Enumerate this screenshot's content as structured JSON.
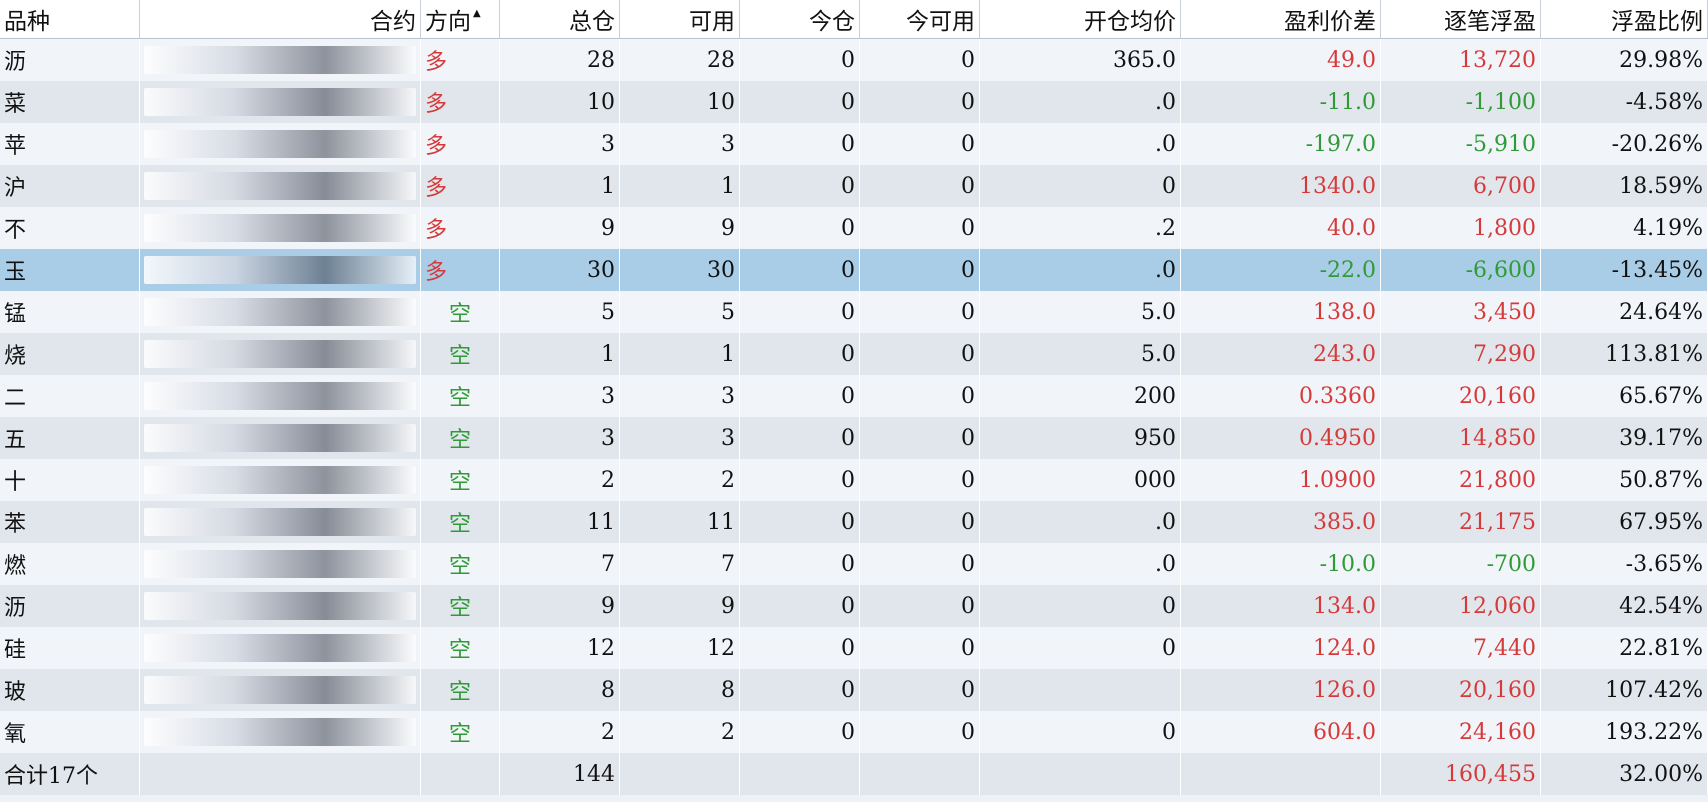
{
  "headers": {
    "variety": "品种",
    "contract": "合约",
    "direction": "方向",
    "total": "总仓",
    "available": "可用",
    "today": "今仓",
    "today_available": "今可用",
    "avg_open": "开仓均价",
    "price_diff": "盈利价差",
    "float_pl": "逐笔浮盈",
    "pl_ratio": "浮盈比例"
  },
  "colors": {
    "long": "#d43a3a",
    "short": "#2f9a36",
    "selected_row": "#a9cde6"
  },
  "rows": [
    {
      "variety": "沥",
      "direction": "多",
      "total": "28",
      "available": "28",
      "today": "0",
      "today_available": "0",
      "avg_open": "365.0",
      "price_diff": "49.0",
      "float_pl": "13,720",
      "pl_ratio": "29.98%",
      "sign": "pos"
    },
    {
      "variety": "菜",
      "direction": "多",
      "total": "10",
      "available": "10",
      "today": "0",
      "today_available": "0",
      "avg_open": ".0",
      "price_diff": "-11.0",
      "float_pl": "-1,100",
      "pl_ratio": "-4.58%",
      "sign": "neg"
    },
    {
      "variety": "苹",
      "direction": "多",
      "total": "3",
      "available": "3",
      "today": "0",
      "today_available": "0",
      "avg_open": ".0",
      "price_diff": "-197.0",
      "float_pl": "-5,910",
      "pl_ratio": "-20.26%",
      "sign": "neg"
    },
    {
      "variety": "沪",
      "direction": "多",
      "total": "1",
      "available": "1",
      "today": "0",
      "today_available": "0",
      "avg_open": "0",
      "price_diff": "1340.0",
      "float_pl": "6,700",
      "pl_ratio": "18.59%",
      "sign": "pos"
    },
    {
      "variety": "不",
      "direction": "多",
      "total": "9",
      "available": "9",
      "today": "0",
      "today_available": "0",
      "avg_open": ".2",
      "price_diff": "40.0",
      "float_pl": "1,800",
      "pl_ratio": "4.19%",
      "sign": "pos"
    },
    {
      "variety": "玉",
      "direction": "多",
      "total": "30",
      "available": "30",
      "today": "0",
      "today_available": "0",
      "avg_open": ".0",
      "price_diff": "-22.0",
      "float_pl": "-6,600",
      "pl_ratio": "-13.45%",
      "sign": "neg",
      "selected": true
    },
    {
      "variety": "锰",
      "direction": "空",
      "total": "5",
      "available": "5",
      "today": "0",
      "today_available": "0",
      "avg_open": "5.0",
      "price_diff": "138.0",
      "float_pl": "3,450",
      "pl_ratio": "24.64%",
      "sign": "pos"
    },
    {
      "variety": "烧",
      "direction": "空",
      "total": "1",
      "available": "1",
      "today": "0",
      "today_available": "0",
      "avg_open": "5.0",
      "price_diff": "243.0",
      "float_pl": "7,290",
      "pl_ratio": "113.81%",
      "sign": "pos"
    },
    {
      "variety": "二",
      "direction": "空",
      "total": "3",
      "available": "3",
      "today": "0",
      "today_available": "0",
      "avg_open": "200",
      "price_diff": "0.3360",
      "float_pl": "20,160",
      "pl_ratio": "65.67%",
      "sign": "pos"
    },
    {
      "variety": "五",
      "direction": "空",
      "total": "3",
      "available": "3",
      "today": "0",
      "today_available": "0",
      "avg_open": "950",
      "price_diff": "0.4950",
      "float_pl": "14,850",
      "pl_ratio": "39.17%",
      "sign": "pos"
    },
    {
      "variety": "十",
      "direction": "空",
      "total": "2",
      "available": "2",
      "today": "0",
      "today_available": "0",
      "avg_open": "000",
      "price_diff": "1.0900",
      "float_pl": "21,800",
      "pl_ratio": "50.87%",
      "sign": "pos"
    },
    {
      "variety": "苯",
      "direction": "空",
      "total": "11",
      "available": "11",
      "today": "0",
      "today_available": "0",
      "avg_open": ".0",
      "price_diff": "385.0",
      "float_pl": "21,175",
      "pl_ratio": "67.95%",
      "sign": "pos"
    },
    {
      "variety": "燃",
      "direction": "空",
      "total": "7",
      "available": "7",
      "today": "0",
      "today_available": "0",
      "avg_open": ".0",
      "price_diff": "-10.0",
      "float_pl": "-700",
      "pl_ratio": "-3.65%",
      "sign": "neg"
    },
    {
      "variety": "沥",
      "direction": "空",
      "total": "9",
      "available": "9",
      "today": "0",
      "today_available": "0",
      "avg_open": "0",
      "price_diff": "134.0",
      "float_pl": "12,060",
      "pl_ratio": "42.54%",
      "sign": "pos"
    },
    {
      "variety": "硅",
      "direction": "空",
      "total": "12",
      "available": "12",
      "today": "0",
      "today_available": "0",
      "avg_open": "0",
      "price_diff": "124.0",
      "float_pl": "7,440",
      "pl_ratio": "22.81%",
      "sign": "pos"
    },
    {
      "variety": "玻",
      "direction": "空",
      "total": "8",
      "available": "8",
      "today": "0",
      "today_available": "0",
      "avg_open": "",
      "price_diff": "126.0",
      "float_pl": "20,160",
      "pl_ratio": "107.42%",
      "sign": "pos"
    },
    {
      "variety": "氧",
      "direction": "空",
      "total": "2",
      "available": "2",
      "today": "0",
      "today_available": "0",
      "avg_open": "0",
      "price_diff": "604.0",
      "float_pl": "24,160",
      "pl_ratio": "193.22%",
      "sign": "pos"
    }
  ],
  "total_row": {
    "label": "合计17个",
    "total": "144",
    "float_pl": "160,455",
    "pl_ratio": "32.00%"
  }
}
